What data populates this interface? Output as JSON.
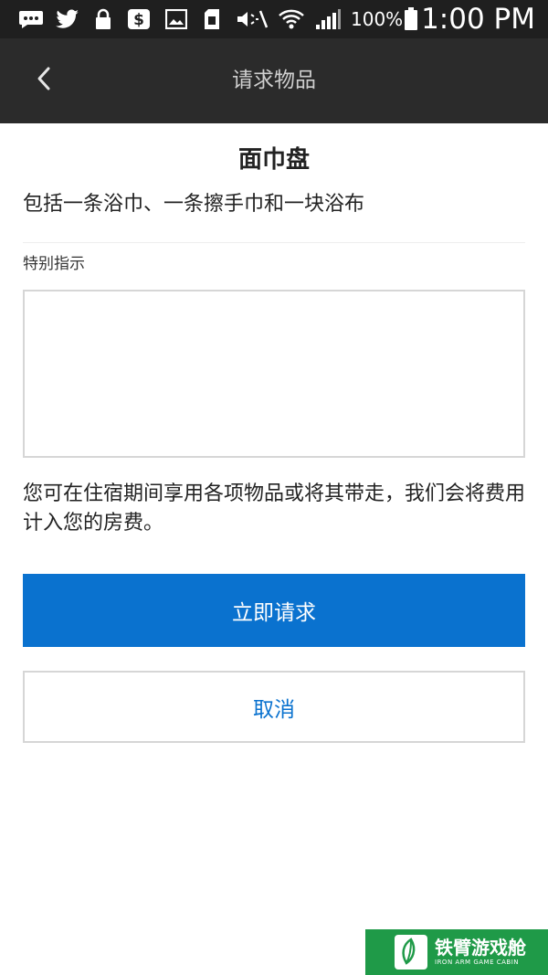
{
  "status_bar": {
    "battery_percent": "100%",
    "time": "1:00 PM",
    "icons": [
      "message-icon",
      "twitter-icon",
      "lock-icon",
      "dollar-icon",
      "gallery-icon",
      "sim-card-icon",
      "mute-icon",
      "wifi-icon",
      "signal-icon",
      "battery-icon"
    ]
  },
  "app_bar": {
    "title": "请求物品",
    "back_icon": "chevron-left-icon"
  },
  "item": {
    "title": "面巾盘",
    "description": "包括一条浴巾、一条擦手巾和一块浴布"
  },
  "instructions": {
    "label": "特别指示",
    "value": "",
    "placeholder": ""
  },
  "note": "您可在住宿期间享用各项物品或将其带走，我们会将费用计入您的房费。",
  "buttons": {
    "submit_label": "立即请求",
    "cancel_label": "取消"
  },
  "watermark": {
    "main": "铁臂游戏舱",
    "sub": "IRON ARM GAME CABIN"
  },
  "colors": {
    "primary": "#0a72cf",
    "status_bar": "#1f1f1f",
    "app_bar": "#2b2b2b",
    "watermark": "#1f9a48"
  }
}
